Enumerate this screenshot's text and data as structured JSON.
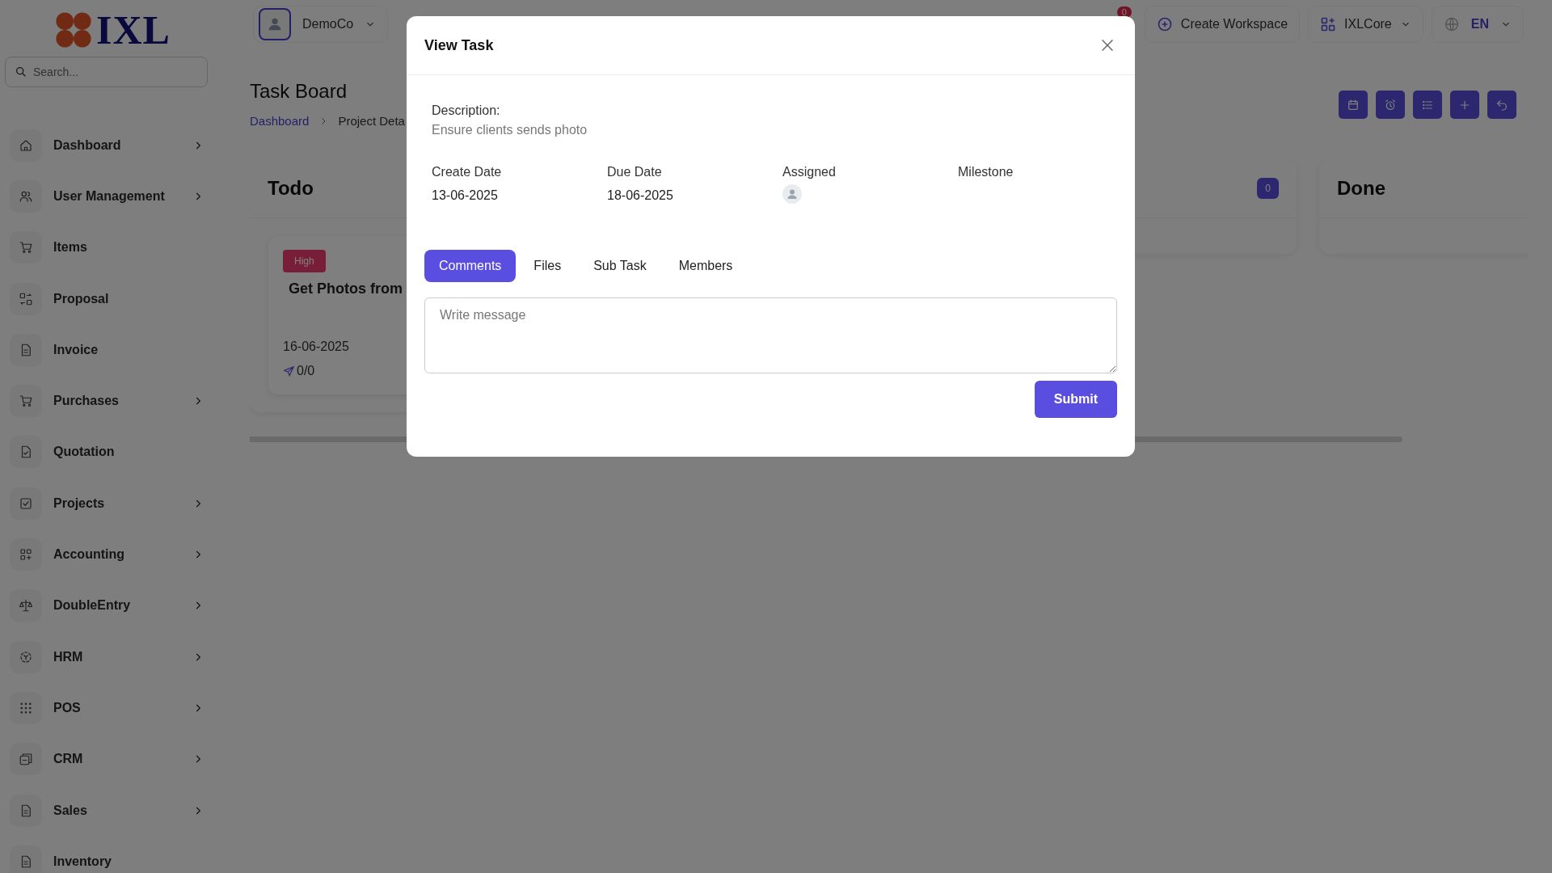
{
  "logo": {
    "text": "IXL"
  },
  "search": {
    "placeholder": "Search..."
  },
  "sidebar": {
    "items": [
      {
        "label": "Dashboard",
        "has_submenu": true
      },
      {
        "label": "User Management",
        "has_submenu": true
      },
      {
        "label": "Items",
        "has_submenu": false
      },
      {
        "label": "Proposal",
        "has_submenu": false
      },
      {
        "label": "Invoice",
        "has_submenu": false
      },
      {
        "label": "Purchases",
        "has_submenu": true
      },
      {
        "label": "Quotation",
        "has_submenu": false
      },
      {
        "label": "Projects",
        "has_submenu": true
      },
      {
        "label": "Accounting",
        "has_submenu": true
      },
      {
        "label": "DoubleEntry",
        "has_submenu": true
      },
      {
        "label": "HRM",
        "has_submenu": true
      },
      {
        "label": "POS",
        "has_submenu": true
      },
      {
        "label": "CRM",
        "has_submenu": true
      },
      {
        "label": "Sales",
        "has_submenu": true
      },
      {
        "label": "Inventory",
        "has_submenu": false
      }
    ]
  },
  "header": {
    "workspace": "DemoCo",
    "notification_count": "0",
    "create_workspace": "Create Workspace",
    "app": "IXLCore",
    "language": "EN"
  },
  "page": {
    "title": "Task Board",
    "breadcrumb": [
      "Dashboard",
      "Project Deta"
    ]
  },
  "board": {
    "columns": [
      {
        "title": "Todo",
        "cards": [
          {
            "priority": "High",
            "title": "Get Photos from",
            "date": "16-06-2025",
            "progress": "0/0"
          }
        ]
      },
      {
        "count": "0"
      },
      {
        "title": "Done"
      }
    ]
  },
  "modal": {
    "title": "View Task",
    "description_label": "Description:",
    "description": "Ensure clients sends photo",
    "fields": [
      {
        "label": "Create Date",
        "kind": "text",
        "value": "13-06-2025"
      },
      {
        "label": "Due Date",
        "kind": "text",
        "value": "18-06-2025"
      },
      {
        "label": "Assigned",
        "kind": "avatar"
      },
      {
        "label": "Milestone",
        "kind": "text"
      }
    ],
    "tabs": [
      {
        "label": "Comments",
        "selected": true
      },
      {
        "label": "Files",
        "selected": false
      },
      {
        "label": "Sub Task",
        "selected": false
      },
      {
        "label": "Members",
        "selected": false
      }
    ],
    "comment": {
      "placeholder": "Write message"
    },
    "submit": "Submit"
  }
}
